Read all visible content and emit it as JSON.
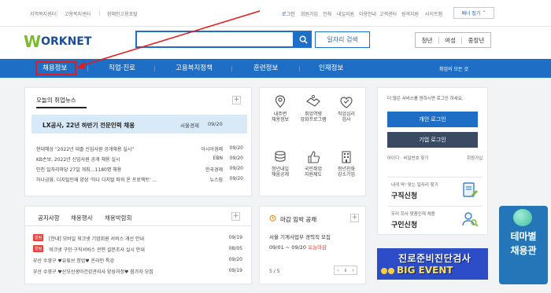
{
  "topbar": {
    "sites": [
      "지역복지센터",
      "고용복지센터",
      "장애인고용포털"
    ],
    "util_links": [
      "로그인",
      "회원가입",
      "전체",
      "내일지원",
      "이용안내",
      "고객센터",
      "원격지원",
      "사이트맵"
    ],
    "banner_fold": "배너 접기"
  },
  "header": {
    "logo_w": "W",
    "logo_text": "ORKNET",
    "search_placeholder": "",
    "job_search_label": "일자리 검색",
    "audience": [
      "청년",
      "여성",
      "중장년"
    ]
  },
  "gnb": {
    "items": [
      "채용정보",
      "직업·진로",
      "고용복지정책",
      "훈련정보",
      "인재정보"
    ],
    "all_menu": "취업의 모든 것"
  },
  "news": {
    "tab": "오늘의 취업뉴스",
    "feature": {
      "title": "LX공사, 22년 하반기 전문인력 채용",
      "source": "서울경제",
      "date": "09/20"
    },
    "rows": [
      {
        "title": "현대해상 \"2022년 대졸 신입사원 공개채용 실시\"",
        "source": "아시아경제",
        "date": "09/20"
      },
      {
        "title": "KB손보, 2022년 신입사원 공개 채용 실시",
        "source": "EBN",
        "date": "09/20"
      },
      {
        "title": "인천 일자리마당 27일 개최…1180명 채용",
        "source": "한국경제",
        "date": "09/20"
      },
      {
        "title": "하나금융, 디지털인재 양성 '하나 디지털 파워 온 프로젝트' …",
        "source": "뉴스핌",
        "date": "09/20"
      }
    ]
  },
  "notice": {
    "tabs": [
      "공지사항",
      "채용행사",
      "채용박람회"
    ],
    "badge": "알림",
    "rows": [
      {
        "badge": true,
        "title": "[안내] 모바일 워크넷 기업회원 서비스 개선 안내",
        "date": "09/19"
      },
      {
        "badge": true,
        "title": "워크넷 구인·구직서비스 관련 설문조사 실시 안내",
        "date": "08/05"
      },
      {
        "badge": false,
        "title": "부산 수영구 ♥유튜브 창업♥ 온라인 특강",
        "date": "09/20"
      },
      {
        "badge": false,
        "title": "부산 수영구 ♥산모신생아건강관리사 양성과정♥ 참가자 모집",
        "date": "09/19"
      }
    ]
  },
  "services": [
    {
      "l1": "내주변",
      "l2": "채용정보",
      "icon": "map-pin-icon"
    },
    {
      "l1": "취업역량",
      "l2": "강화프로그램",
      "icon": "handshake-icon"
    },
    {
      "l1": "직업심리",
      "l2": "검사",
      "icon": "check-heart-icon"
    },
    {
      "l1": "청년내일",
      "l2": "채움공제",
      "icon": "coin-stack-icon"
    },
    {
      "l1": "국민취업",
      "l2": "지원제도",
      "icon": "thumbs-up-icon"
    },
    {
      "l1": "청년친화",
      "l2": "강소기업",
      "icon": "building-icon"
    }
  ],
  "deadline": {
    "title": "마감 임박 공채",
    "org": "서울  기계사업부 경력직 모집",
    "date": "09/01 ~ 09/20",
    "today": "오늘마감",
    "pager": "5 / 5"
  },
  "login": {
    "message": "더 많은 서비스를 원하시면 로그인 하세요.",
    "personal": "개인 로그인",
    "company": "기업 로그인",
    "find": "아이디 · 비밀번호 찾기",
    "join": "회원가입",
    "promo_jobseeker_small": "내게 딱! 맞는 일자리 찾기",
    "promo_jobseeker_big": "구직신청",
    "promo_employer_small": "우리 회사 맞춤인재 채용",
    "promo_employer_big": "구인신청"
  },
  "event_banner": {
    "line1": "진로준비진단검사",
    "line2": "BIG EVENT"
  },
  "theme_banner": {
    "line1": "테마별",
    "line2": "채용관"
  },
  "colors": {
    "primary": "#1f6ec5",
    "dark_button": "#3a4a63",
    "highlight": "#e21d1d",
    "brand_green": "#7dbb2e"
  }
}
